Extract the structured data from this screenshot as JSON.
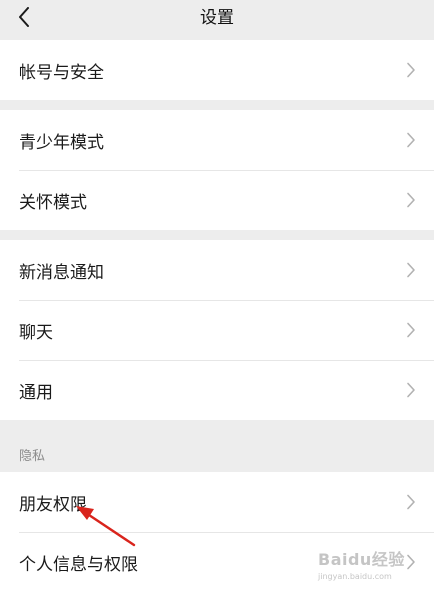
{
  "header": {
    "title": "设置",
    "back_icon": "chevron-left-icon"
  },
  "groups": [
    {
      "items": [
        {
          "label": "帐号与安全"
        }
      ]
    },
    {
      "items": [
        {
          "label": "青少年模式"
        },
        {
          "label": "关怀模式"
        }
      ]
    },
    {
      "items": [
        {
          "label": "新消息通知"
        },
        {
          "label": "聊天"
        },
        {
          "label": "通用"
        }
      ]
    }
  ],
  "privacy_section": {
    "header": "隐私",
    "items": [
      {
        "label": "朋友权限"
      },
      {
        "label": "个人信息与权限"
      }
    ]
  },
  "annotation": {
    "arrow_color": "#d9241c",
    "points_to": "朋友权限"
  },
  "watermark": {
    "brand": "Baidu经验",
    "sub": "jingyan.baidu.com"
  },
  "colors": {
    "background": "#ededed",
    "row": "#ffffff",
    "text": "#1a1a1a",
    "chevron": "#b2b2b2"
  }
}
